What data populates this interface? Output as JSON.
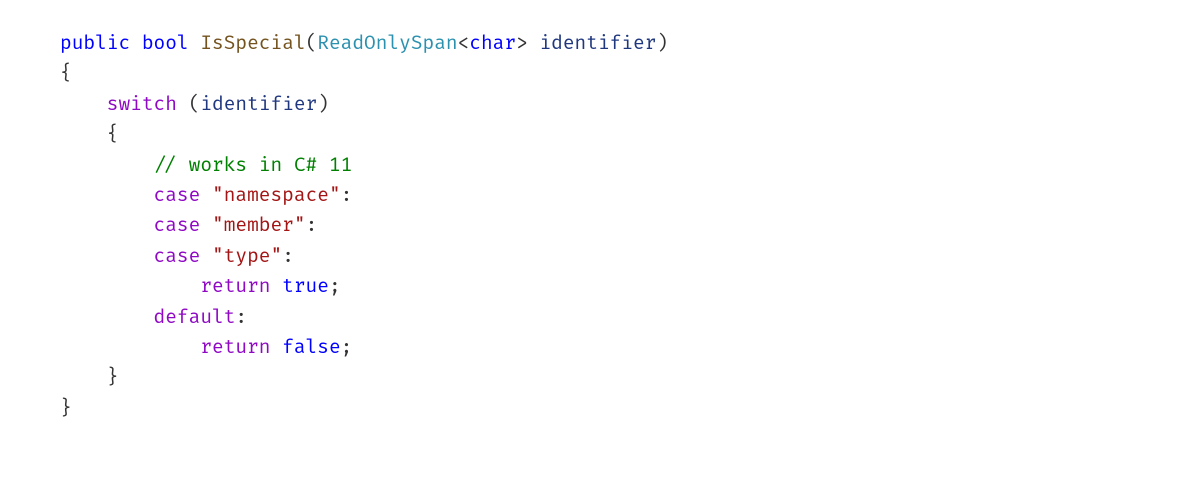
{
  "code": {
    "tokens": {
      "public": "public",
      "bool": "bool",
      "method": "IsSpecial",
      "lparen": "(",
      "readonlyspan": "ReadOnlySpan",
      "lt": "<",
      "char": "char",
      "gt": ">",
      "param": "identifier",
      "rparen": ")",
      "lbrace": "{",
      "switch": "switch",
      "sw_lparen": "(",
      "sw_ident": "identifier",
      "sw_rparen": ")",
      "sw_lbrace": "{",
      "comment": "// works in C# 11",
      "case1": "case",
      "str1": "\"namespace\"",
      "colon1": ":",
      "case2": "case",
      "str2": "\"member\"",
      "colon2": ":",
      "case3": "case",
      "str3": "\"type\"",
      "colon3": ":",
      "return1": "return",
      "true": "true",
      "semi1": ";",
      "default": "default",
      "colon4": ":",
      "return2": "return",
      "false": "false",
      "semi2": ";",
      "sw_rbrace": "}",
      "rbrace": "}"
    }
  }
}
